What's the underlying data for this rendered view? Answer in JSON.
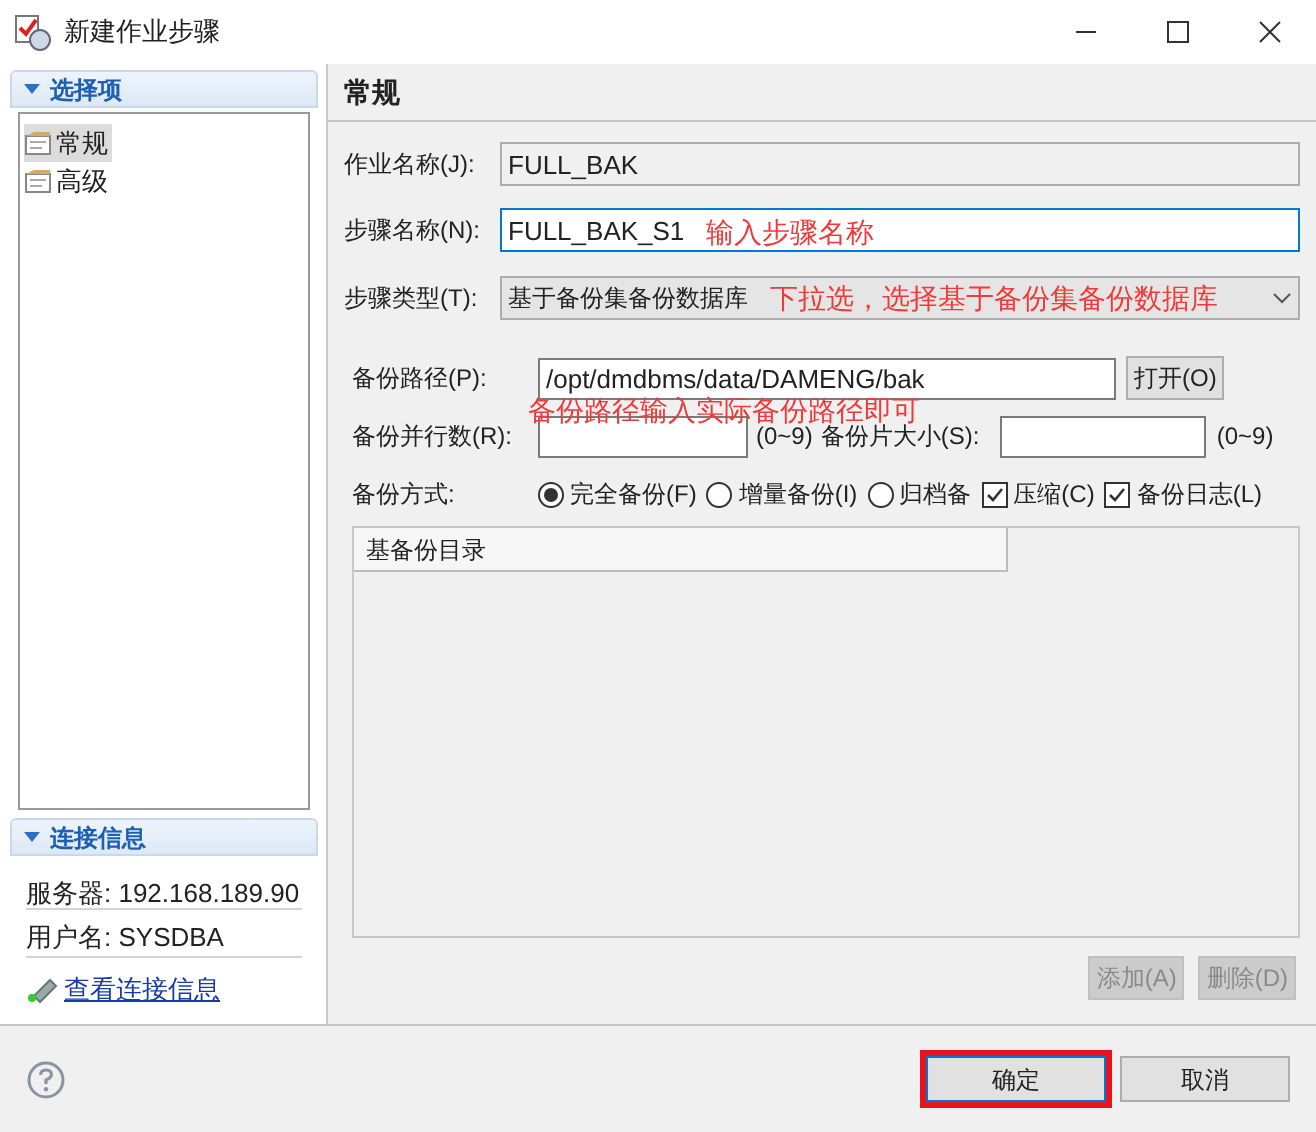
{
  "window": {
    "title": "新建作业步骤"
  },
  "sidebar": {
    "title": "选择项",
    "expanded": true,
    "items": [
      {
        "label": "常规",
        "selected": true
      },
      {
        "label": "高级",
        "selected": false
      }
    ]
  },
  "connection": {
    "title": "连接信息",
    "expanded": true,
    "server": "服务器: 192.168.189.90",
    "user": "用户名: SYSDBA",
    "link": "查看连接信息"
  },
  "panel": {
    "title": "常规",
    "job_name": {
      "label": "作业名称(J):",
      "value": "FULL_BAK",
      "disabled": true
    },
    "step_name": {
      "label": "步骤名称(N):",
      "value": "FULL_BAK_S1",
      "disabled": false
    },
    "step_type": {
      "label": "步骤类型(T):",
      "value": "基于备份集备份数据库"
    },
    "backup_path": {
      "label": "备份路径(P):",
      "value": "/opt/dmdbms/data/DAMENG/bak",
      "button": "打开(O)"
    },
    "parallel": {
      "label": "备份并行数(R):",
      "hint": "(0~9)"
    },
    "piece_size": {
      "label": "备份片大小(S):",
      "hint": "(0~9)"
    },
    "mode_label": "备份方式:",
    "options": [
      {
        "kind": "radio",
        "label": "完全备份(F)",
        "checked": true
      },
      {
        "kind": "radio",
        "label": "增量备份(I)",
        "checked": false
      },
      {
        "kind": "radio",
        "label": "归档备",
        "checked": false
      },
      {
        "kind": "checkbox",
        "label": "压缩(C)",
        "checked": true
      },
      {
        "kind": "checkbox",
        "label": "备份日志(L)",
        "checked": true
      }
    ],
    "table": {
      "columns": [
        "基备份目录"
      ]
    },
    "buttons": [
      {
        "label": "添加(A)",
        "disabled": true
      },
      {
        "label": "删除(D)",
        "disabled": true
      }
    ]
  },
  "annotations": [
    {
      "text": "输入步骤名称"
    },
    {
      "text": "下拉选，选择基于备份集备份数据库"
    },
    {
      "text": "备份路径输入实际备份路径即可"
    }
  ],
  "footer_buttons": [
    {
      "label": "确定",
      "highlighted": true
    },
    {
      "label": "取消",
      "highlighted": false
    }
  ]
}
